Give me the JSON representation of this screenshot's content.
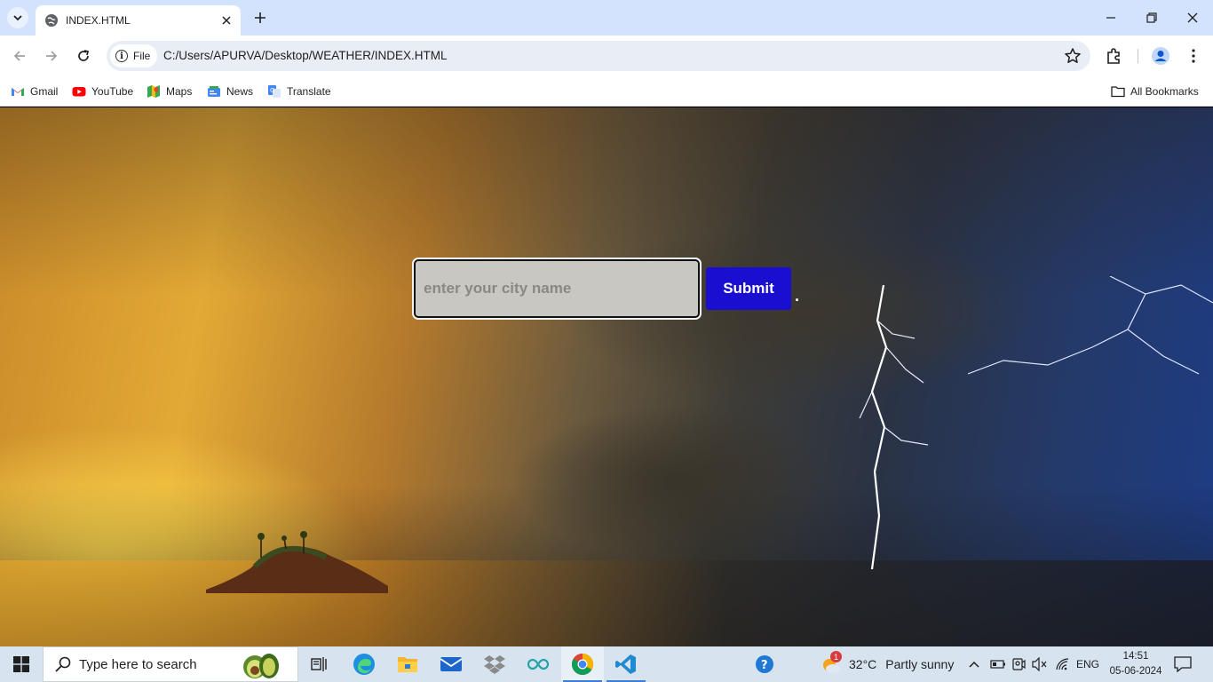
{
  "browser": {
    "tab_title": "INDEX.HTML",
    "site_chip": "File",
    "url": "C:/Users/APURVA/Desktop/WEATHER/INDEX.HTML"
  },
  "bookmarks": {
    "items": [
      {
        "label": "Gmail",
        "icon": "gmail-icon"
      },
      {
        "label": "YouTube",
        "icon": "youtube-icon"
      },
      {
        "label": "Maps",
        "icon": "maps-icon"
      },
      {
        "label": "News",
        "icon": "news-icon"
      },
      {
        "label": "Translate",
        "icon": "translate-icon"
      }
    ],
    "all_bookmarks": "All Bookmarks"
  },
  "page": {
    "city_placeholder": "enter your city name",
    "submit_label": "Submit",
    "trailing_text": "."
  },
  "taskbar": {
    "search_placeholder": "Type here to search",
    "weather_badge": "1",
    "weather_temp": "32°C",
    "weather_desc": "Partly sunny",
    "language": "ENG",
    "time": "14:51",
    "date": "05-06-2024"
  },
  "colors": {
    "submit_bg": "#1a0fd1",
    "tabstrip_bg": "#d3e3fd",
    "taskbar_bg": "#d7e4ef"
  }
}
